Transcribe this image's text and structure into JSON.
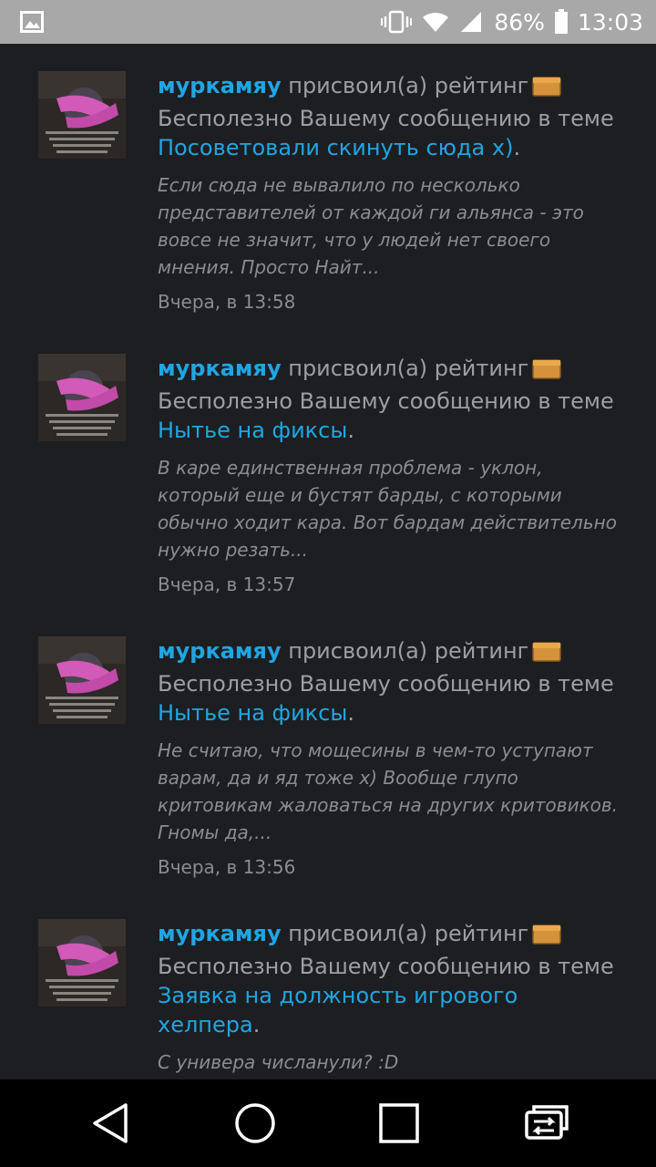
{
  "status_bar": {
    "battery_percent": "86%",
    "time": "13:03",
    "icons": [
      "gallery-icon",
      "vibrate-icon",
      "wifi-icon",
      "signal-icon",
      "battery-icon"
    ]
  },
  "feed": [
    {
      "user": "муркамяу",
      "action": "присвоил(а) рейтинг",
      "rating_icon": "box-icon",
      "rating_text": "Бесполезно Вашему сообщению в теме",
      "topic": "Посоветовали скинуть сюда х)",
      "topic_suffix": ".",
      "quote": "Если сюда не вывалило по несколько представителей от каждой ги альянса - это вовсе не значит, что у людей нет своего мнения. Просто Найт...",
      "time": "Вчера, в 13:58"
    },
    {
      "user": "муркамяу",
      "action": "присвоил(а) рейтинг",
      "rating_icon": "box-icon",
      "rating_text": "Бесполезно Вашему сообщению в теме",
      "topic": "Нытье на фиксы",
      "topic_suffix": ".",
      "quote": "В каре единственная проблема - уклон, который еще и бустят барды, с которыми обычно ходит кара. Вот бардам действительно нужно резать...",
      "time": "Вчера, в 13:57"
    },
    {
      "user": "муркамяу",
      "action": "присвоил(а) рейтинг",
      "rating_icon": "box-icon",
      "rating_text": "Бесполезно Вашему сообщению в теме",
      "topic": "Нытье на фиксы",
      "topic_suffix": ".",
      "quote": "Не считаю, что мощесины в чем-то уступают варам, да и яд тоже х) Вообще глупо критовикам жаловаться на других критовиков. Гномы да,...",
      "time": "Вчера, в 13:56"
    },
    {
      "user": "муркамяу",
      "action": "присвоил(а) рейтинг",
      "rating_icon": "box-icon",
      "rating_text": "Бесполезно Вашему сообщению в теме",
      "topic": "Заявка на должность игрового хелпера",
      "topic_suffix": ".",
      "quote": "С универа числанули? :D",
      "time": ""
    }
  ],
  "nav_bar": [
    "back-icon",
    "home-icon",
    "recents-icon",
    "switch-app-icon"
  ]
}
